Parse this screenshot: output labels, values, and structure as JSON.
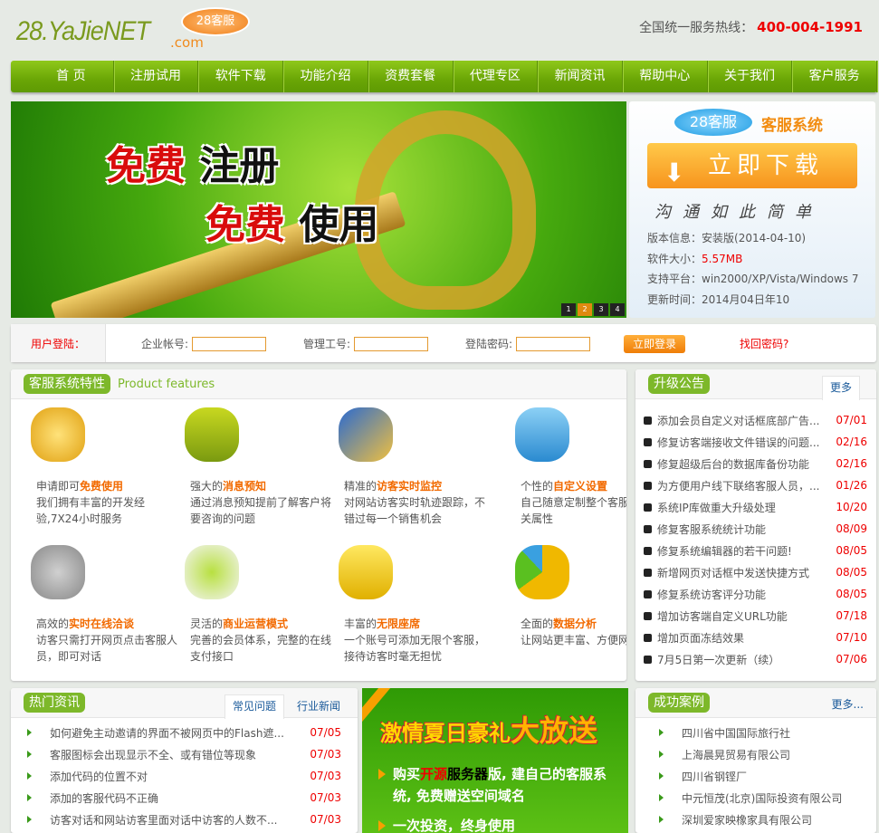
{
  "header": {
    "logo_text": "28.YaJieNET",
    "logo_com": ".com",
    "logo_badge": "28客服",
    "hotline_label": "全国统一服务热线：",
    "hotline_number": "400-004-1991"
  },
  "nav": [
    "首 页",
    "注册试用",
    "软件下载",
    "功能介绍",
    "资费套餐",
    "代理专区",
    "新闻资讯",
    "帮助中心",
    "关于我们",
    "客户服务"
  ],
  "banner": {
    "line1_red": "免费",
    "line1_black": "注册",
    "line2_red": "免费",
    "line2_black": "使用",
    "slides": [
      "1",
      "2",
      "3",
      "4"
    ],
    "active_slide": 2
  },
  "download": {
    "badge": "28客服",
    "system": "客服系统",
    "button": "立即下载",
    "slogan": "沟通如此简单",
    "version_label": "版本信息：",
    "version": "安装版(2014-04-10)",
    "size_label": "软件大小：",
    "size": "5.57MB",
    "platform_label": "支持平台：",
    "platform": "win2000/XP/Vista/Windows 7",
    "updated_label": "更新时间：",
    "updated": "2014月04日年10"
  },
  "login": {
    "label": "用户登陆：",
    "account_label": "企业帐号:",
    "staff_label": "管理工号:",
    "password_label": "登陆密码:",
    "submit": "立即登录",
    "forgot": "找回密码?"
  },
  "features": {
    "title": "客服系统特性",
    "subtitle": "Product features",
    "items": [
      {
        "icon": "gold-coins-icon",
        "pre": "申请即可",
        "hl": "免费使用",
        "desc": "我们拥有丰富的开发经验,7X24小时服务"
      },
      {
        "icon": "shield-check-icon",
        "pre": "强大的",
        "hl": "消息预知",
        "desc": "通过消息预知提前了解客户将要咨询的问题"
      },
      {
        "icon": "monitor-palette-icon",
        "pre": "精准的",
        "hl": "访客实时监控",
        "desc": "对网站访客实时轨迹跟踪，不错过每一个销售机会"
      },
      {
        "icon": "blocks-pencil-icon",
        "pre": "个性的",
        "hl": "自定义设置",
        "desc": "自己随意定制整个客服系统相关属性"
      },
      {
        "icon": "gears-icon",
        "pre": "高效的",
        "hl": "实时在线洽谈",
        "desc": "访客只需打开网页点击客服人员，即可对话"
      },
      {
        "icon": "sprout-egg-icon",
        "pre": "灵活的",
        "hl": "商业运营模式",
        "desc": "完善的会员体系，完整的在线支付接口"
      },
      {
        "icon": "window-brush-icon",
        "pre": "丰富的",
        "hl": "无限座席",
        "desc": "一个账号可添加无限个客服，接待访客时毫无担忧"
      },
      {
        "icon": "pie-chart-icon",
        "pre": "全面的",
        "hl": "数据分析",
        "desc": "让网站更丰富、方便网站扩展"
      }
    ]
  },
  "upgrades": {
    "title": "升级公告",
    "more": "更多",
    "items": [
      {
        "t": "添加会员自定义对话框底部广告...",
        "d": "07/01"
      },
      {
        "t": "修复访客端接收文件错误的问题...",
        "d": "02/16"
      },
      {
        "t": "修复超级后台的数据库备份功能",
        "d": "02/16"
      },
      {
        "t": "为方便用户线下联络客服人员，...",
        "d": "01/26"
      },
      {
        "t": "系统IP库做重大升级处理",
        "d": "10/20"
      },
      {
        "t": "修复客服系统统计功能",
        "d": "08/09"
      },
      {
        "t": "修复系统编辑器的若干问题!",
        "d": "08/05"
      },
      {
        "t": "新增网页对话框中发送快捷方式",
        "d": "08/05"
      },
      {
        "t": "修复系统访客评分功能",
        "d": "08/05"
      },
      {
        "t": "增加访客端自定义URL功能",
        "d": "07/18"
      },
      {
        "t": "增加页面冻结效果",
        "d": "07/10"
      },
      {
        "t": "7月5日第一次更新（续）",
        "d": "07/06"
      }
    ]
  },
  "hot": {
    "title": "热门资讯",
    "tabs": [
      "常见问题",
      "行业新闻"
    ],
    "items": [
      {
        "t": "如何避免主动邀请的界面不被网页中的Flash遮...",
        "d": "07/05"
      },
      {
        "t": "客服图标会出现显示不全、或有错位等现象",
        "d": "07/03"
      },
      {
        "t": "添加代码的位置不对",
        "d": "07/03"
      },
      {
        "t": "添加的客服代码不正确",
        "d": "07/03"
      },
      {
        "t": "访客对话和网站访客里面对话中访客的人数不...",
        "d": "07/03"
      }
    ]
  },
  "promo": {
    "headline": "激情夏日豪礼",
    "headline_big": "大放送",
    "p1_a": "购买",
    "p1_red": "开源",
    "p1_black": "服务器",
    "p1_b": "版, 建自己的客服系统, 免费赠送空间域名",
    "p2": "一次投资，终身使用"
  },
  "cases": {
    "title": "成功案例",
    "more": "更多...",
    "items": [
      "四川省中国国际旅行社",
      "上海晨晃贸易有限公司",
      "四川省钢铿厂",
      "中元恒茂(北京)国际投资有限公司",
      "深圳爱家映橡家具有限公司"
    ]
  }
}
